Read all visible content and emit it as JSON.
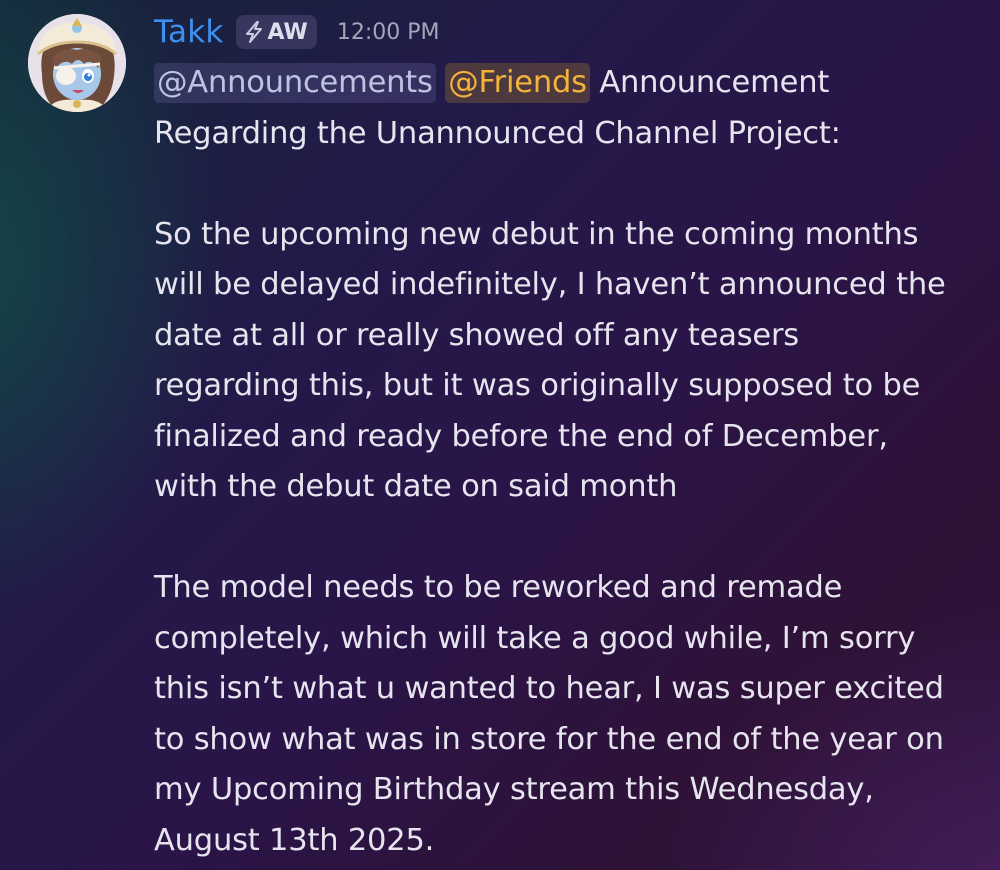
{
  "author": {
    "name": "Takk",
    "tag": "AW",
    "tag_icon": "lightning-icon",
    "avatar": "anime-character-avatar"
  },
  "timestamp": "12:00 PM",
  "mentions": [
    "@Announcements",
    "@Friends"
  ],
  "colors": {
    "username": "#3d8ff0",
    "mention_announcements": "#bfc3e2",
    "mention_friends": "#f3b43a",
    "text": "#e6e4ee",
    "timestamp": "#a3a6b8"
  },
  "message": {
    "intro_line1": "Announcement",
    "intro_line2": "Regarding the Unannounced Channel Project:",
    "paragraph1": "So the upcoming new debut in the coming months\nwill be delayed indefinitely, I haven’t announced the\ndate at all or really showed off any teasers\nregarding this, but it was originally supposed to be\nfinalized and ready before the end of December,\nwith the debut date on said month",
    "paragraph2": "The model needs to be reworked and remade\ncompletely, which will take a good while, I’m sorry\nthis isn’t what u wanted to hear, I was super excited\nto show what was in store for the end of the year on\nmy Upcoming Birthday stream this Wednesday,\nAugust 13th 2025."
  }
}
